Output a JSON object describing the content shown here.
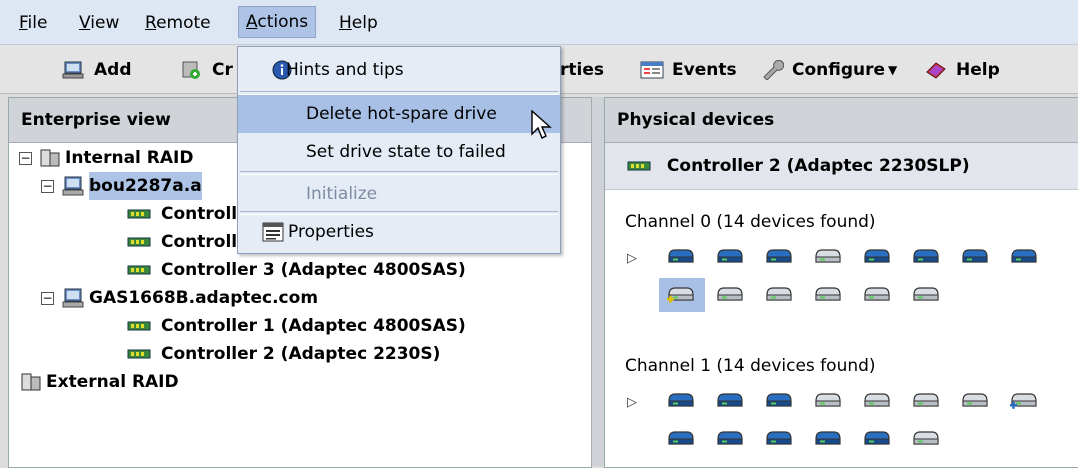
{
  "menubar": {
    "items": [
      {
        "id": "file",
        "mnemonic": "F",
        "rest": "ile"
      },
      {
        "id": "view",
        "mnemonic": "V",
        "rest": "iew"
      },
      {
        "id": "remote",
        "mnemonic": "R",
        "rest": "emote"
      },
      {
        "id": "actions",
        "mnemonic": "A",
        "rest": "ctions"
      },
      {
        "id": "help",
        "mnemonic": "H",
        "rest": "elp"
      }
    ]
  },
  "toolbar": {
    "add_label": "Add",
    "create_label": "Cr",
    "properties_label": "rties",
    "events_label": "Events",
    "configure_label": "Configure",
    "help_label": "Help"
  },
  "actions_menu": {
    "items": [
      {
        "label": "Hints and tips",
        "icon": "info-icon",
        "state": "normal"
      },
      {
        "label": "Delete hot-spare drive",
        "icon": "",
        "state": "highlighted"
      },
      {
        "label": "Set drive state to failed",
        "icon": "",
        "state": "normal"
      },
      {
        "label": "Initialize",
        "icon": "",
        "state": "disabled"
      },
      {
        "label": "Properties",
        "icon": "properties-icon",
        "state": "normal"
      }
    ]
  },
  "enterprise_view": {
    "title": "Enterprise view",
    "tree": {
      "internal_raid": "Internal RAID",
      "server1": "bou2287a.a",
      "s1_ctrl1": "Controll",
      "s1_ctrl2": "Controll",
      "s1_ctrl3": "Controller 3 (Adaptec 4800SAS)",
      "server2": "GAS1668B.adaptec.com",
      "s2_ctrl1": "Controller 1 (Adaptec 4800SAS)",
      "s2_ctrl2": "Controller 2 (Adaptec 2230S)",
      "external_raid": "External RAID"
    }
  },
  "physical_devices": {
    "title": "Physical devices",
    "controller": "Controller 2 (Adaptec 2230SLP)",
    "channel0": "Channel 0  (14 devices found)",
    "channel1": "Channel 1  (14 devices found)"
  },
  "colors": {
    "menu_highlight": "#a8c0e6",
    "drive_blue": "#2a6ec0",
    "drive_grey": "#d8dde4"
  }
}
